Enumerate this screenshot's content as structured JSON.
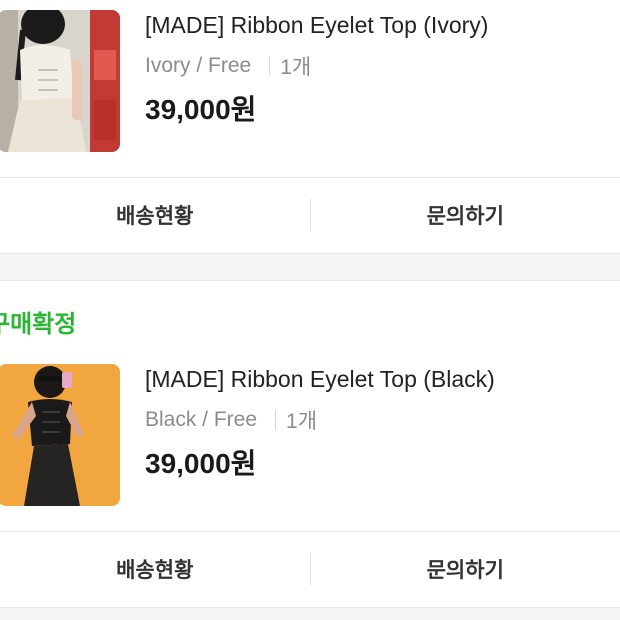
{
  "orders": [
    {
      "status": "",
      "product_name": "[MADE] Ribbon Eyelet Top (Ivory)",
      "option": "Ivory / Free",
      "quantity": "1개",
      "price": "39,000원",
      "actions": {
        "shipping_label": "배송현황",
        "inquiry_label": "문의하기"
      }
    },
    {
      "status": "구매확정",
      "product_name": "[MADE] Ribbon Eyelet Top (Black)",
      "option": "Black / Free",
      "quantity": "1개",
      "price": "39,000원",
      "actions": {
        "shipping_label": "배송현황",
        "inquiry_label": "문의하기"
      }
    }
  ],
  "colors": {
    "status_green": "#2bb534",
    "option_gray": "#8c8c8c",
    "divider": "#e6e6e6",
    "section_gap": "#f4f4f4"
  }
}
